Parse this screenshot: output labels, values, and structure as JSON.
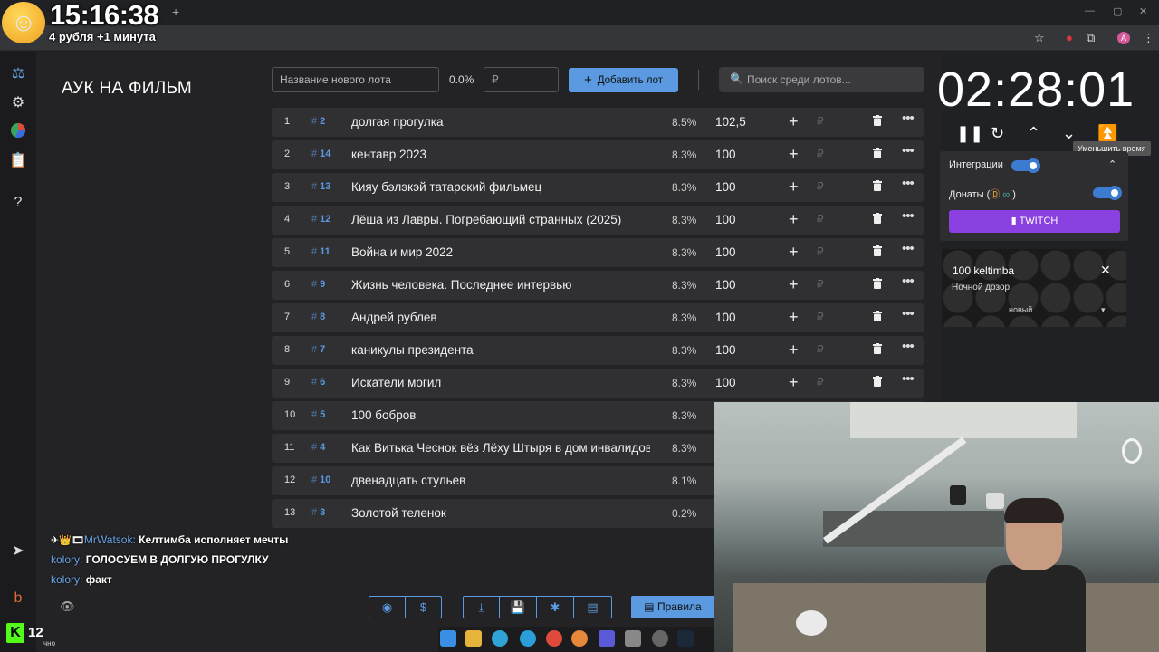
{
  "overlay": {
    "clock": "15:16:38",
    "subtitle": "4 рубля +1 минута"
  },
  "page": {
    "title": "АУК НА ФИЛЬМ"
  },
  "new_lot": {
    "name_placeholder": "Название нового лота",
    "percent": "0.0%",
    "amount_placeholder": "₽",
    "add_label": "Добавить лот"
  },
  "search": {
    "placeholder": "Поиск среди лотов..."
  },
  "lots": [
    {
      "index": "1",
      "fast_id": "2",
      "name": "долгая прогулка",
      "percent": "8.5%",
      "amount": "102,5"
    },
    {
      "index": "2",
      "fast_id": "14",
      "name": "кентавр 2023",
      "percent": "8.3%",
      "amount": "100"
    },
    {
      "index": "3",
      "fast_id": "13",
      "name": "Кияу бэлэкэй татарский фильмец",
      "percent": "8.3%",
      "amount": "100"
    },
    {
      "index": "4",
      "fast_id": "12",
      "name": "Лёша из Лавры. Погребающий странных (2025)",
      "percent": "8.3%",
      "amount": "100"
    },
    {
      "index": "5",
      "fast_id": "11",
      "name": "Война и мир 2022",
      "percent": "8.3%",
      "amount": "100"
    },
    {
      "index": "6",
      "fast_id": "9",
      "name": "Жизнь человека. Последнее интервью",
      "percent": "8.3%",
      "amount": "100"
    },
    {
      "index": "7",
      "fast_id": "8",
      "name": "Андрей рублев",
      "percent": "8.3%",
      "amount": "100"
    },
    {
      "index": "8",
      "fast_id": "7",
      "name": "каникулы президента",
      "percent": "8.3%",
      "amount": "100"
    },
    {
      "index": "9",
      "fast_id": "6",
      "name": "Искатели могил",
      "percent": "8.3%",
      "amount": "100"
    },
    {
      "index": "10",
      "fast_id": "5",
      "name": "100 бобров",
      "percent": "8.3%",
      "amount": ""
    },
    {
      "index": "11",
      "fast_id": "4",
      "name": "Как Витька Чеснок вёз Лёху Штыря в дом инвалидов",
      "percent": "8.3%",
      "amount": ""
    },
    {
      "index": "12",
      "fast_id": "10",
      "name": "двенадцать стульев",
      "percent": "8.1%",
      "amount": ""
    },
    {
      "index": "13",
      "fast_id": "3",
      "name": "Золотой теленок",
      "percent": "0.2%",
      "amount": ""
    }
  ],
  "lot_row": {
    "fast_prefix": "#",
    "currency": "₽"
  },
  "timer": {
    "value": "02:28:01",
    "tooltip": "Уменьшить время"
  },
  "integrations": {
    "label": "Интеграции",
    "donations_label": "Донаты (",
    "donations_suffix": ")",
    "twitch_label": "TWITCH"
  },
  "donation_card": {
    "title": "100 keltimba",
    "message": "Ночной дозор",
    "status": "новый"
  },
  "chat": [
    {
      "user": "MrWatsok:",
      "text": "Келтимба исполняет мечты",
      "color": "#6aa4e8"
    },
    {
      "user": "kolory:",
      "text": "ГОЛОСУЕМ В ДОЛГУЮ ПРОГУЛКУ",
      "color": "#6aa4e8"
    },
    {
      "user": "kolory:",
      "text": "факт",
      "color": "#6aa4e8"
    }
  ],
  "footer": {
    "rules_label": "Правила"
  },
  "kick": {
    "logo": "K",
    "viewers": "12",
    "sub": "чно"
  },
  "colors": {
    "accent": "#5b9ae0",
    "twitch": "#8a3fe0",
    "row_bg": "#303033"
  }
}
